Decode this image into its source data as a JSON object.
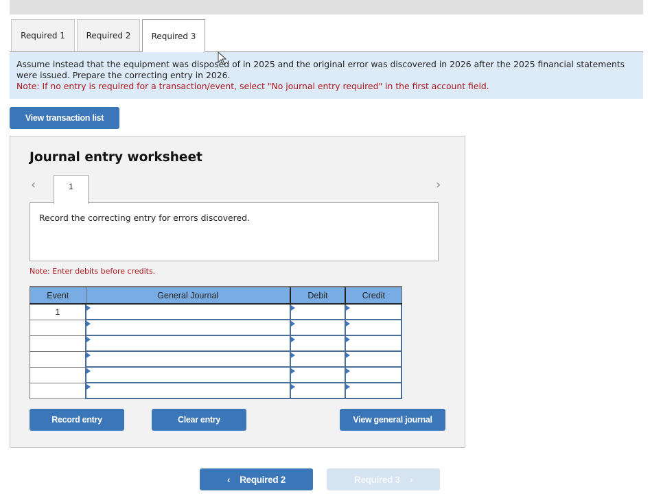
{
  "tabs": [
    {
      "label": "Required 1",
      "active": false
    },
    {
      "label": "Required 2",
      "active": false
    },
    {
      "label": "Required 3",
      "active": true
    }
  ],
  "instructions": {
    "text": "Assume instead that the equipment was disposed of in 2025 and the original error was discovered in 2026 after the 2025 financial statements were issued. Prepare the correcting entry in 2026.",
    "note": "Note: If no entry is required for a transaction/event, select \"No journal entry required\" in the first account field."
  },
  "view_transaction_list_label": "View transaction list",
  "worksheet": {
    "title": "Journal entry worksheet",
    "prev_icon": "chevron-left-icon",
    "next_icon": "chevron-right-icon",
    "entry_tab_label": "1",
    "description": "Record the correcting entry for errors discovered.",
    "note": "Note: Enter debits before credits.",
    "table": {
      "headers": [
        "Event",
        "General Journal",
        "Debit",
        "Credit"
      ],
      "rows": [
        {
          "event": "1",
          "account": "",
          "debit": "",
          "credit": ""
        },
        {
          "event": "",
          "account": "",
          "debit": "",
          "credit": ""
        },
        {
          "event": "",
          "account": "",
          "debit": "",
          "credit": ""
        },
        {
          "event": "",
          "account": "",
          "debit": "",
          "credit": ""
        },
        {
          "event": "",
          "account": "",
          "debit": "",
          "credit": ""
        },
        {
          "event": "",
          "account": "",
          "debit": "",
          "credit": ""
        }
      ]
    },
    "buttons": {
      "record": "Record entry",
      "clear": "Clear entry",
      "view_journal": "View general journal"
    }
  },
  "navigation": {
    "prev_label": "Required 2",
    "next_label": "Required 3",
    "next_enabled": false
  },
  "colors": {
    "primary_button": "#3b76b9",
    "disabled_button": "#d6e3f1",
    "info_background": "#dcebf7",
    "note_red": "#b0141a",
    "table_header": "#78ace3"
  }
}
